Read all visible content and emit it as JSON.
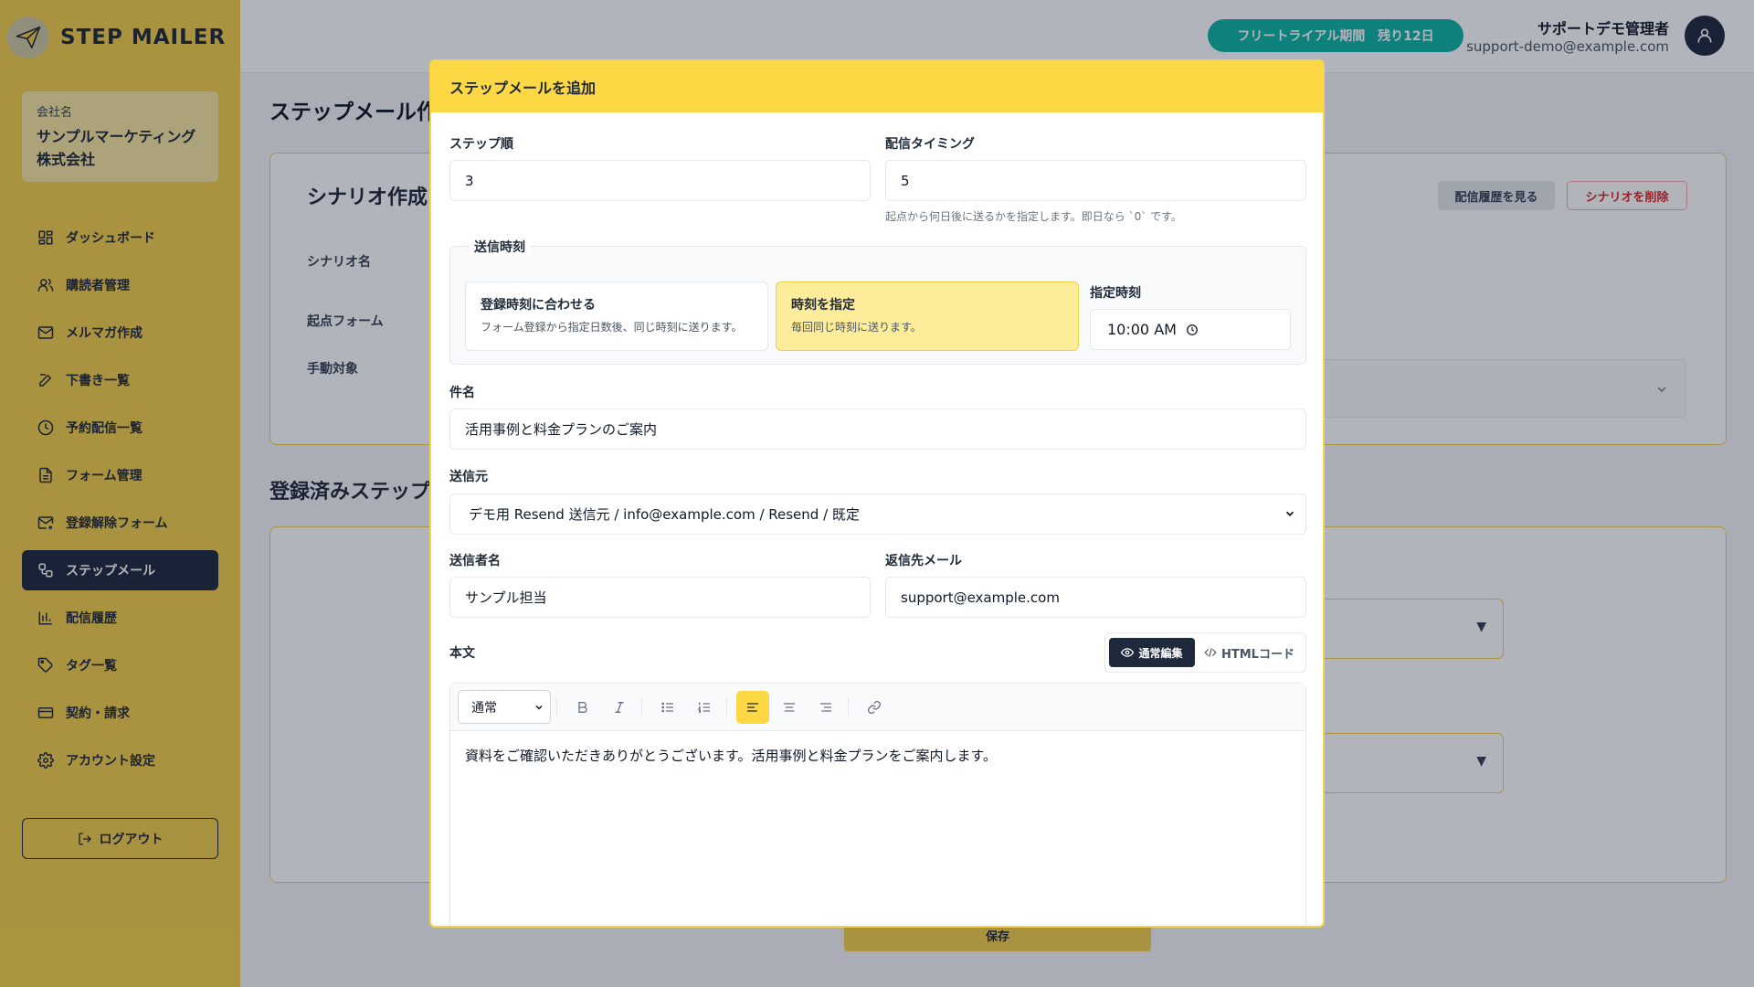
{
  "app": {
    "logo_text": "STEP MAILER",
    "company_label": "会社名",
    "company_name": "サンプルマーケティング株式会社",
    "logout_label": "ログアウト"
  },
  "sidebar": {
    "items": [
      {
        "label": "ダッシュボード",
        "icon": "dashboard-icon"
      },
      {
        "label": "購読者管理",
        "icon": "users-icon"
      },
      {
        "label": "メルマガ作成",
        "icon": "mail-icon"
      },
      {
        "label": "下書き一覧",
        "icon": "edit-icon"
      },
      {
        "label": "予約配信一覧",
        "icon": "clock-icon"
      },
      {
        "label": "フォーム管理",
        "icon": "file-icon"
      },
      {
        "label": "登録解除フォーム",
        "icon": "mail-x-icon"
      },
      {
        "label": "ステップメール",
        "icon": "workflow-icon",
        "active": true
      },
      {
        "label": "配信履歴",
        "icon": "bar-chart-icon"
      },
      {
        "label": "タグ一覧",
        "icon": "tag-icon"
      },
      {
        "label": "契約・請求",
        "icon": "credit-card-icon"
      },
      {
        "label": "アカウント設定",
        "icon": "gear-icon"
      }
    ]
  },
  "header": {
    "trial_badge": "フリートライアル期間　残り12日",
    "user_name": "サポートデモ管理者",
    "user_email": "support-demo@example.com"
  },
  "background": {
    "page_title": "ステップメール作成",
    "card_title": "シナリオ作成",
    "label_scenario_name": "シナリオ名",
    "label_origin_form": "起点フォーム",
    "label_manual_target": "手動対象",
    "btn_history": "配信履歴を見る",
    "btn_delete": "シナリオを削除",
    "section_title": "登録済みステップ",
    "save_label": "保存"
  },
  "modal": {
    "title": "ステップメールを追加",
    "step_order_label": "ステップ順",
    "step_order_value": "3",
    "timing_label": "配信タイミング",
    "timing_value": "5",
    "timing_hint": "起点から何日後に送るかを指定します。即日なら `0` です。",
    "send_time_legend": "送信時刻",
    "option_match": {
      "title": "登録時刻に合わせる",
      "desc": "フォーム登録から指定日数後、同じ時刻に送ります。"
    },
    "option_fixed": {
      "title": "時刻を指定",
      "desc": "毎回同じ時刻に送ります。"
    },
    "fixed_time_label": "指定時刻",
    "fixed_time_value": "10:00 AM",
    "subject_label": "件名",
    "subject_value": "活用事例と料金プランのご案内",
    "sender_label": "送信元",
    "sender_value": "デモ用 Resend 送信元 / info@example.com / Resend / 既定",
    "sender_name_label": "送信者名",
    "sender_name_value": "サンプル担当",
    "reply_to_label": "返信先メール",
    "reply_to_value": "support@example.com",
    "body_label": "本文",
    "mode_normal": "通常編集",
    "mode_html": "HTMLコード",
    "format_select": "通常",
    "body_text": "資料をご確認いただきありがとうございます。活用事例と料金プランをご案内します。"
  },
  "colors": {
    "sidebar_bg": "#f3cf4a",
    "accent": "#fcd845",
    "active_nav": "#1e293b",
    "trial_badge": "#0fb4a2",
    "danger": "#dc2626"
  }
}
